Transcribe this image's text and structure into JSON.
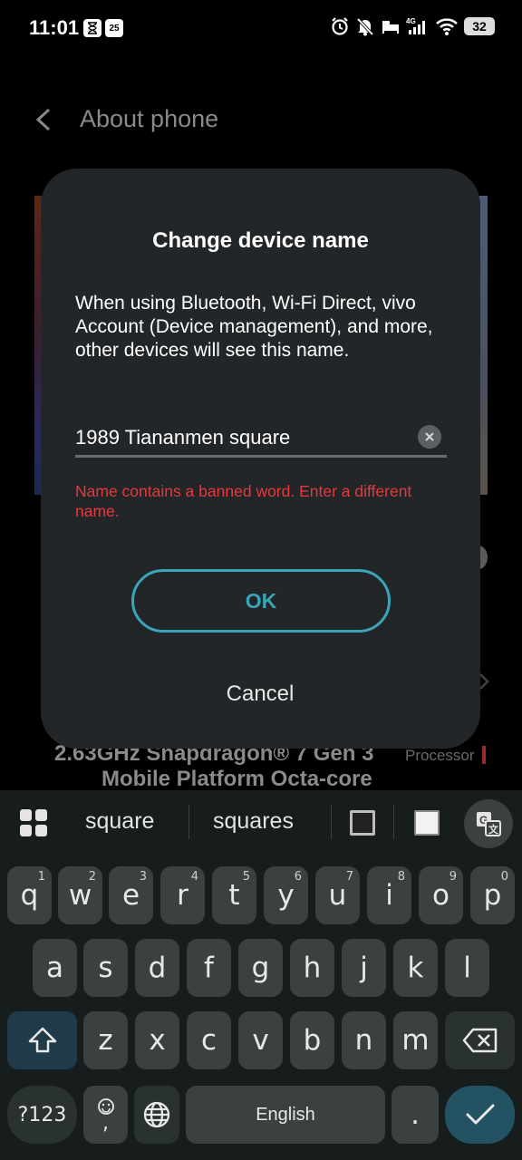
{
  "status_bar": {
    "time": "11:01",
    "notif_badge": "25",
    "network": "4G",
    "battery": "32"
  },
  "background": {
    "title": "About phone",
    "spec_line1": "2.63GHz Snapdragon® 7 Gen 3",
    "spec_processor": "Processor",
    "spec_line2": "Mobile Platform Octa-core"
  },
  "dialog": {
    "title": "Change device name",
    "body": "When using Bluetooth, Wi-Fi Direct, vivo Account (Device management), and more, other devices will see this name.",
    "input_value": "1989 Tiananmen square",
    "error": "Name contains a banned word. Enter a different name.",
    "ok_label": "OK",
    "cancel_label": "Cancel",
    "accent_color": "#3aa4b8",
    "error_color": "#e8383c"
  },
  "keyboard": {
    "suggestions": [
      "square",
      "squares"
    ],
    "row1": [
      {
        "k": "q",
        "n": "1"
      },
      {
        "k": "w",
        "n": "2"
      },
      {
        "k": "e",
        "n": "3"
      },
      {
        "k": "r",
        "n": "4"
      },
      {
        "k": "t",
        "n": "5"
      },
      {
        "k": "y",
        "n": "6"
      },
      {
        "k": "u",
        "n": "7"
      },
      {
        "k": "i",
        "n": "8"
      },
      {
        "k": "o",
        "n": "9"
      },
      {
        "k": "p",
        "n": "0"
      }
    ],
    "row2": [
      "a",
      "s",
      "d",
      "f",
      "g",
      "h",
      "j",
      "k",
      "l"
    ],
    "row3": [
      "z",
      "x",
      "c",
      "v",
      "b",
      "n",
      "m"
    ],
    "sym_label": "?123",
    "comma_label": ",",
    "space_label": "English",
    "period_label": "."
  }
}
